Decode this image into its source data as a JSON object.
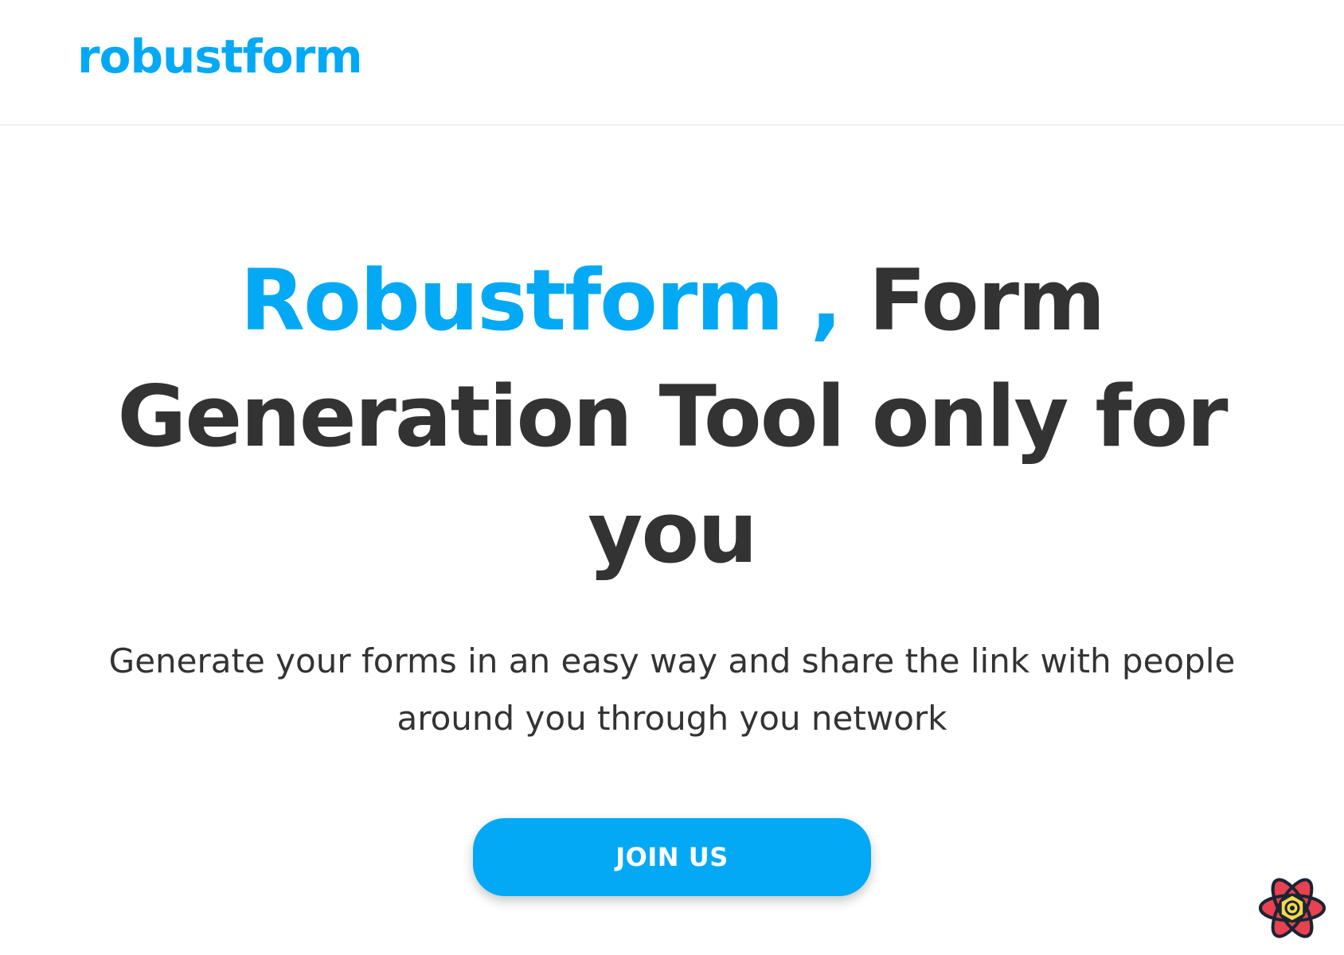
{
  "header": {
    "logo_text": "robustform"
  },
  "hero": {
    "title_accent": "Robustform ,",
    "title_rest": "Form Generation Tool only for you",
    "subtitle": "Generate your forms in an easy way and share the link with people around you through you network",
    "cta_label": "JOIN US"
  },
  "colors": {
    "brand": "#03a9f4",
    "text": "#333333",
    "background": "#ffffff"
  },
  "icons": {
    "floating": "react-devtools-icon"
  }
}
